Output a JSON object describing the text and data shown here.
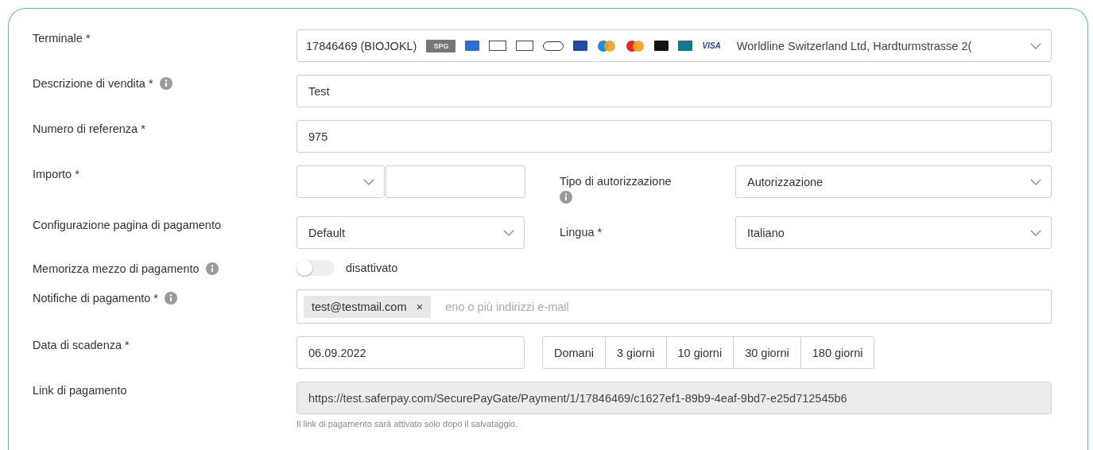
{
  "terminal": {
    "label": "Terminale *",
    "value": "17846469 (BIOJOKL)",
    "logos": [
      {
        "kind": "tag",
        "label": "SPG"
      },
      {
        "kind": "card",
        "color": "#2a6fd6"
      },
      {
        "kind": "outline"
      },
      {
        "kind": "outline"
      },
      {
        "kind": "pill"
      },
      {
        "kind": "card",
        "color": "#1f4aa8"
      },
      {
        "kind": "circles",
        "color": "#1b8fe0"
      },
      {
        "kind": "circles",
        "color": "#e8281e"
      },
      {
        "kind": "card",
        "color": "#111111"
      },
      {
        "kind": "card",
        "color": "#0f7a8c"
      },
      {
        "kind": "wordmark",
        "label": "VISA"
      }
    ],
    "address": "Worldline Switzerland Ltd, Hardturmstrasse 2("
  },
  "description": {
    "label": "Descrizione di vendita *",
    "info": true,
    "value": "Test"
  },
  "reference": {
    "label": "Numero di referenza *",
    "value": "975"
  },
  "amount": {
    "label": "Importo *"
  },
  "auth_type": {
    "label": "Tipo di autorizzazione",
    "info": true,
    "value": "Autorizzazione"
  },
  "page_config": {
    "label": "Configurazione pagina di pagamento",
    "value": "Default"
  },
  "language": {
    "label": "Lingua *",
    "value": "Italiano"
  },
  "store_method": {
    "label": "Memorizza mezzo di pagamento",
    "info": true,
    "on": false,
    "state_text": "disattivato"
  },
  "notifications": {
    "label": "Notifiche di pagamento *",
    "info": true,
    "chips": [
      {
        "label": "test@testmail.com",
        "remove": "×"
      }
    ],
    "placeholder": "eno o più indirizzi e-mail"
  },
  "expiry": {
    "label": "Data di scadenza *",
    "value": "06.09.2022",
    "quick": [
      {
        "label": "Domani",
        "selected": false
      },
      {
        "label": "3 giorni",
        "selected": false
      },
      {
        "label": "10 giorni",
        "selected": false
      },
      {
        "label": "30 giorni",
        "selected": false
      },
      {
        "label": "180 giorni",
        "selected": false
      }
    ]
  },
  "link": {
    "label": "Link di pagamento",
    "value": "https://test.saferpay.com/SecurePayGate/Payment/1/17846469/c1627ef1-89b9-4eaf-9bd7-e25d712545b6",
    "disabled": true,
    "hint": "Il link di pagamento sarà attivato solo dopo il salvataggio."
  }
}
